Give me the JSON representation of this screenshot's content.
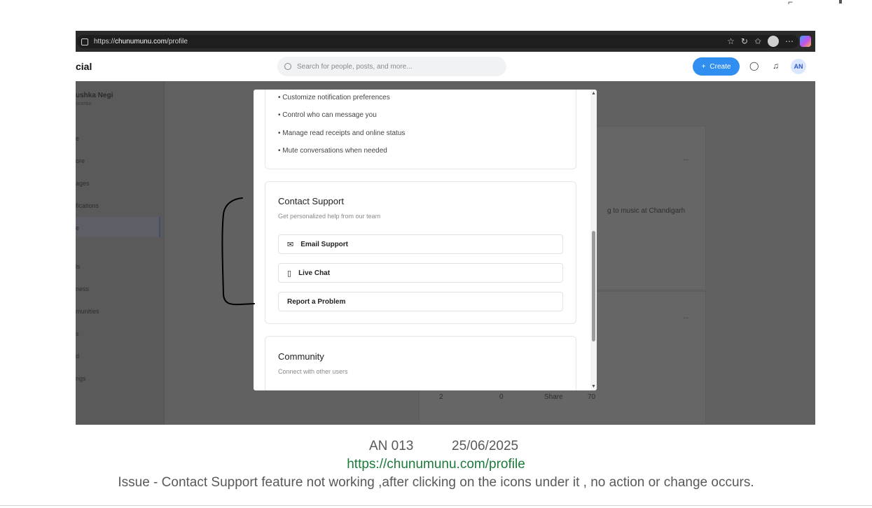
{
  "browser": {
    "url_prefix": "https://",
    "url_host": "chunumunu.com",
    "url_path": "/profile"
  },
  "header": {
    "brand": "cial",
    "search_placeholder": "Search for people, posts, and more...",
    "create_label": "Create",
    "avatar_initials": "AN"
  },
  "sidebar": {
    "user_name": "ushka Negi",
    "user_handle": "nushka",
    "items": [
      "e",
      "ore",
      "ages",
      "fications",
      "e",
      "ls",
      "ness",
      "munities",
      "s",
      "d",
      "ngs"
    ]
  },
  "feed": {
    "post_text": "g to music at Chandigarh",
    "more_glyph": "...",
    "stats": [
      "2",
      "0",
      "Share",
      "70"
    ]
  },
  "modal": {
    "privacy_bullets": [
      "• Customize notification preferences",
      "• Control who can message you",
      "• Manage read receipts and online status",
      "• Mute conversations when needed"
    ],
    "contact": {
      "title": "Contact Support",
      "description": "Get personalized help from our team",
      "options": [
        "Email Support",
        "Live Chat",
        "Report a Problem"
      ]
    },
    "community": {
      "title": "Community",
      "description": "Connect with other users"
    }
  },
  "caption": {
    "id": "AN 013",
    "date": "25/06/2025",
    "link": "https://chunumunu.com/profile",
    "issue": "Issue - Contact Support feature not working ,after clicking on the icons under it , no action or change occurs."
  },
  "colors": {
    "accent": "#2f8ef0",
    "link": "#1b7a3a",
    "overlay": "#616161"
  }
}
